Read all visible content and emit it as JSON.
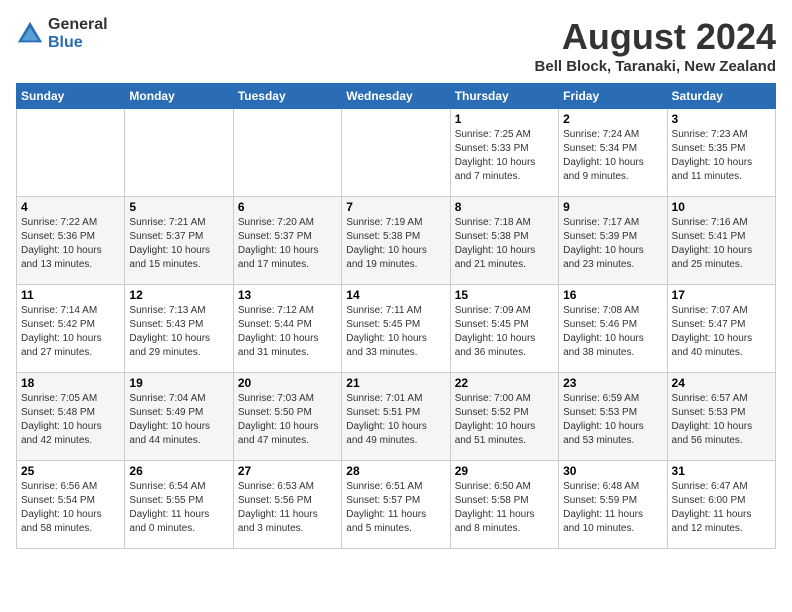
{
  "header": {
    "logo_general": "General",
    "logo_blue": "Blue",
    "title": "August 2024",
    "subtitle": "Bell Block, Taranaki, New Zealand"
  },
  "calendar": {
    "days_of_week": [
      "Sunday",
      "Monday",
      "Tuesday",
      "Wednesday",
      "Thursday",
      "Friday",
      "Saturday"
    ],
    "weeks": [
      [
        {
          "day": "",
          "info": ""
        },
        {
          "day": "",
          "info": ""
        },
        {
          "day": "",
          "info": ""
        },
        {
          "day": "",
          "info": ""
        },
        {
          "day": "1",
          "info": "Sunrise: 7:25 AM\nSunset: 5:33 PM\nDaylight: 10 hours\nand 7 minutes."
        },
        {
          "day": "2",
          "info": "Sunrise: 7:24 AM\nSunset: 5:34 PM\nDaylight: 10 hours\nand 9 minutes."
        },
        {
          "day": "3",
          "info": "Sunrise: 7:23 AM\nSunset: 5:35 PM\nDaylight: 10 hours\nand 11 minutes."
        }
      ],
      [
        {
          "day": "4",
          "info": "Sunrise: 7:22 AM\nSunset: 5:36 PM\nDaylight: 10 hours\nand 13 minutes."
        },
        {
          "day": "5",
          "info": "Sunrise: 7:21 AM\nSunset: 5:37 PM\nDaylight: 10 hours\nand 15 minutes."
        },
        {
          "day": "6",
          "info": "Sunrise: 7:20 AM\nSunset: 5:37 PM\nDaylight: 10 hours\nand 17 minutes."
        },
        {
          "day": "7",
          "info": "Sunrise: 7:19 AM\nSunset: 5:38 PM\nDaylight: 10 hours\nand 19 minutes."
        },
        {
          "day": "8",
          "info": "Sunrise: 7:18 AM\nSunset: 5:38 PM\nDaylight: 10 hours\nand 21 minutes."
        },
        {
          "day": "9",
          "info": "Sunrise: 7:17 AM\nSunset: 5:39 PM\nDaylight: 10 hours\nand 23 minutes."
        },
        {
          "day": "10",
          "info": "Sunrise: 7:16 AM\nSunset: 5:41 PM\nDaylight: 10 hours\nand 25 minutes."
        }
      ],
      [
        {
          "day": "11",
          "info": "Sunrise: 7:14 AM\nSunset: 5:42 PM\nDaylight: 10 hours\nand 27 minutes."
        },
        {
          "day": "12",
          "info": "Sunrise: 7:13 AM\nSunset: 5:43 PM\nDaylight: 10 hours\nand 29 minutes."
        },
        {
          "day": "13",
          "info": "Sunrise: 7:12 AM\nSunset: 5:44 PM\nDaylight: 10 hours\nand 31 minutes."
        },
        {
          "day": "14",
          "info": "Sunrise: 7:11 AM\nSunset: 5:45 PM\nDaylight: 10 hours\nand 33 minutes."
        },
        {
          "day": "15",
          "info": "Sunrise: 7:09 AM\nSunset: 5:45 PM\nDaylight: 10 hours\nand 36 minutes."
        },
        {
          "day": "16",
          "info": "Sunrise: 7:08 AM\nSunset: 5:46 PM\nDaylight: 10 hours\nand 38 minutes."
        },
        {
          "day": "17",
          "info": "Sunrise: 7:07 AM\nSunset: 5:47 PM\nDaylight: 10 hours\nand 40 minutes."
        }
      ],
      [
        {
          "day": "18",
          "info": "Sunrise: 7:05 AM\nSunset: 5:48 PM\nDaylight: 10 hours\nand 42 minutes."
        },
        {
          "day": "19",
          "info": "Sunrise: 7:04 AM\nSunset: 5:49 PM\nDaylight: 10 hours\nand 44 minutes."
        },
        {
          "day": "20",
          "info": "Sunrise: 7:03 AM\nSunset: 5:50 PM\nDaylight: 10 hours\nand 47 minutes."
        },
        {
          "day": "21",
          "info": "Sunrise: 7:01 AM\nSunset: 5:51 PM\nDaylight: 10 hours\nand 49 minutes."
        },
        {
          "day": "22",
          "info": "Sunrise: 7:00 AM\nSunset: 5:52 PM\nDaylight: 10 hours\nand 51 minutes."
        },
        {
          "day": "23",
          "info": "Sunrise: 6:59 AM\nSunset: 5:53 PM\nDaylight: 10 hours\nand 53 minutes."
        },
        {
          "day": "24",
          "info": "Sunrise: 6:57 AM\nSunset: 5:53 PM\nDaylight: 10 hours\nand 56 minutes."
        }
      ],
      [
        {
          "day": "25",
          "info": "Sunrise: 6:56 AM\nSunset: 5:54 PM\nDaylight: 10 hours\nand 58 minutes."
        },
        {
          "day": "26",
          "info": "Sunrise: 6:54 AM\nSunset: 5:55 PM\nDaylight: 11 hours\nand 0 minutes."
        },
        {
          "day": "27",
          "info": "Sunrise: 6:53 AM\nSunset: 5:56 PM\nDaylight: 11 hours\nand 3 minutes."
        },
        {
          "day": "28",
          "info": "Sunrise: 6:51 AM\nSunset: 5:57 PM\nDaylight: 11 hours\nand 5 minutes."
        },
        {
          "day": "29",
          "info": "Sunrise: 6:50 AM\nSunset: 5:58 PM\nDaylight: 11 hours\nand 8 minutes."
        },
        {
          "day": "30",
          "info": "Sunrise: 6:48 AM\nSunset: 5:59 PM\nDaylight: 11 hours\nand 10 minutes."
        },
        {
          "day": "31",
          "info": "Sunrise: 6:47 AM\nSunset: 6:00 PM\nDaylight: 11 hours\nand 12 minutes."
        }
      ]
    ]
  }
}
